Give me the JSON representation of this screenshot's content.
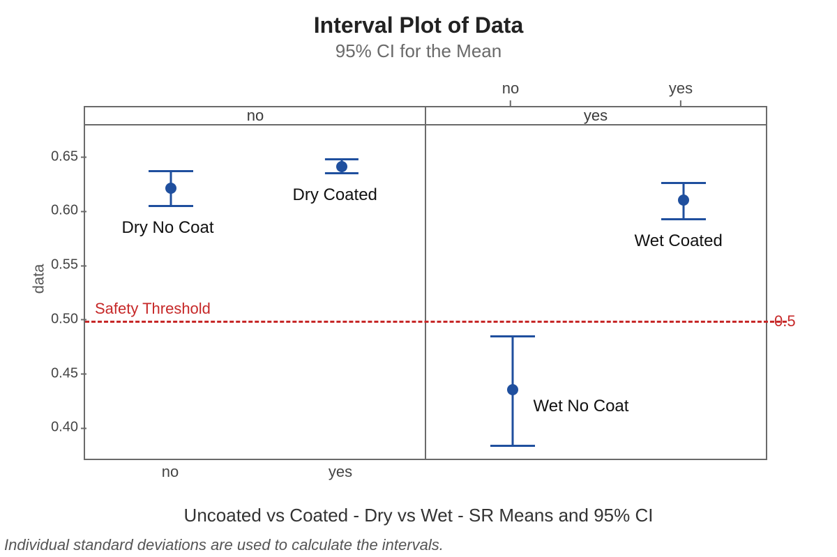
{
  "chart_data": {
    "type": "interval",
    "title": "Interval Plot of Data",
    "subtitle": "95% CI for the Mean",
    "ylabel": "data",
    "xlabel": "Uncoated vs Coated - Dry vs Wet - SR Means and 95% CI",
    "footnote": "Individual standard deviations are used to calculate the intervals.",
    "ylim": [
      0.37,
      0.68
    ],
    "yticks": [
      0.4,
      0.45,
      0.5,
      0.55,
      0.6,
      0.65
    ],
    "panel_labels": {
      "inner_left": "no",
      "inner_right": "yes",
      "top_ext": [
        "no",
        "yes"
      ],
      "bottom": [
        "no",
        "yes"
      ]
    },
    "threshold": {
      "label": "Safety Threshold",
      "value_text": "0.5",
      "value": 0.5
    },
    "series": [
      {
        "name": "Dry No Coat",
        "panel": "left",
        "sub": 0,
        "mean": 0.622,
        "lo": 0.606,
        "hi": 0.638,
        "ann_side": "below"
      },
      {
        "name": "Dry Coated",
        "panel": "left",
        "sub": 1,
        "mean": 0.642,
        "lo": 0.636,
        "hi": 0.649,
        "ann_side": "below"
      },
      {
        "name": "Wet No Coat",
        "panel": "right",
        "sub": 0,
        "mean": 0.436,
        "lo": 0.385,
        "hi": 0.486,
        "ann_side": "right-below"
      },
      {
        "name": "Wet Coated",
        "panel": "right",
        "sub": 1,
        "mean": 0.611,
        "lo": 0.594,
        "hi": 0.627,
        "ann_side": "below"
      }
    ],
    "ytick_labels": {
      "t0": "0.40",
      "t1": "0.45",
      "t2": "0.50",
      "t3": "0.55",
      "t4": "0.60",
      "t5": "0.65"
    }
  }
}
